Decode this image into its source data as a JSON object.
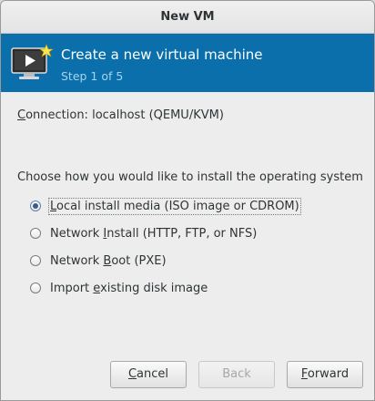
{
  "window": {
    "title": "New VM"
  },
  "banner": {
    "icon": "monitor-play-icon",
    "title": "Create a new virtual machine",
    "step": "Step 1 of 5"
  },
  "connection": {
    "label_prefix": "C",
    "label_rest": "onnection:",
    "value": "localhost (QEMU/KVM)"
  },
  "install": {
    "prompt": "Choose how you would like to install the operating system",
    "options": [
      {
        "pre": "",
        "key": "L",
        "post": "ocal install media (ISO image or CDROM)",
        "selected": true
      },
      {
        "pre": "Network ",
        "key": "I",
        "post": "nstall (HTTP, FTP, or NFS)",
        "selected": false
      },
      {
        "pre": "Network ",
        "key": "B",
        "post": "oot (PXE)",
        "selected": false
      },
      {
        "pre": "Import ",
        "key": "e",
        "post": "xisting disk image",
        "selected": false
      }
    ]
  },
  "buttons": {
    "cancel": {
      "key": "C",
      "rest": "ancel"
    },
    "back": {
      "label": "Back"
    },
    "forward": {
      "key": "F",
      "rest": "orward"
    }
  },
  "colors": {
    "banner": "#0a6fab",
    "step_text": "#a8d4ef"
  }
}
